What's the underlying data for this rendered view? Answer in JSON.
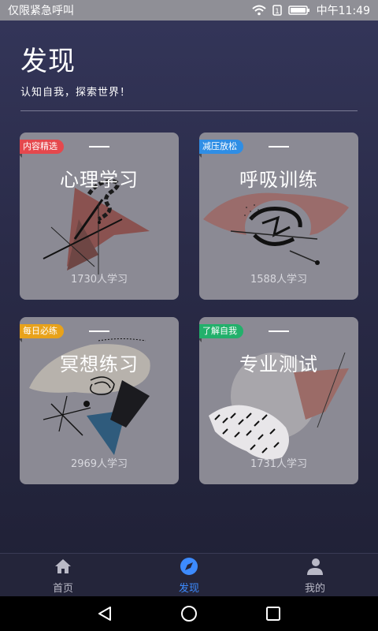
{
  "status_bar": {
    "left_text": "仅限紧急呼叫",
    "right_text": "中午11:49",
    "icons": [
      "wifi-icon",
      "alarm-icon",
      "battery-icon"
    ]
  },
  "header": {
    "title": "发现",
    "subtitle": "认知自我，探索世界！"
  },
  "cards": [
    {
      "tag": "内容精选",
      "tag_color": "#e5484d",
      "title": "心理学习",
      "count": "1730人学习"
    },
    {
      "tag": "减压放松",
      "tag_color": "#2f8ee5",
      "title": "呼吸训练",
      "count": "1588人学习"
    },
    {
      "tag": "每日必练",
      "tag_color": "#e8a21a",
      "title": "冥想练习",
      "count": "2969人学习"
    },
    {
      "tag": "了解自我",
      "tag_color": "#22b06b",
      "title": "专业测试",
      "count": "1731人学习"
    }
  ],
  "tabbar": {
    "tabs": [
      {
        "label": "首页",
        "icon": "home-icon",
        "active": false
      },
      {
        "label": "发现",
        "icon": "compass-icon",
        "active": true
      },
      {
        "label": "我的",
        "icon": "person-icon",
        "active": false
      }
    ]
  },
  "nav": {
    "buttons": [
      "back-icon",
      "home-circle-icon",
      "recent-apps-icon"
    ]
  }
}
